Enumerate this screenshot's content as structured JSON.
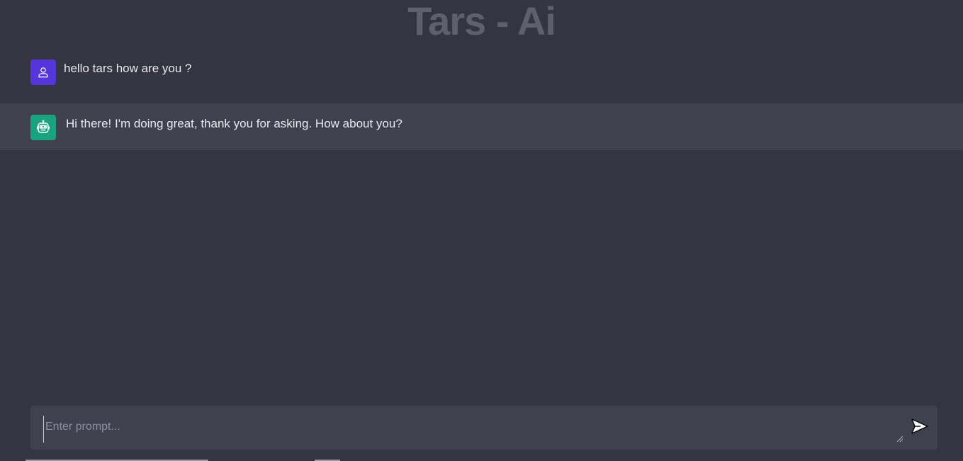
{
  "header": {
    "title": "Tars - Ai"
  },
  "messages": [
    {
      "role": "user",
      "avatar_icon": "user-icon",
      "text": "hello tars how are you ?"
    },
    {
      "role": "bot",
      "avatar_icon": "robot-icon",
      "text": "Hi there! I'm doing great, thank you for asking. How about you?"
    }
  ],
  "composer": {
    "value": "",
    "placeholder": "Enter prompt...",
    "send_icon": "send-icon"
  },
  "colors": {
    "background": "#343541",
    "bot_row": "#40414f",
    "user_avatar": "#5436da",
    "bot_avatar": "#19a37f",
    "title": "#5f606c"
  }
}
